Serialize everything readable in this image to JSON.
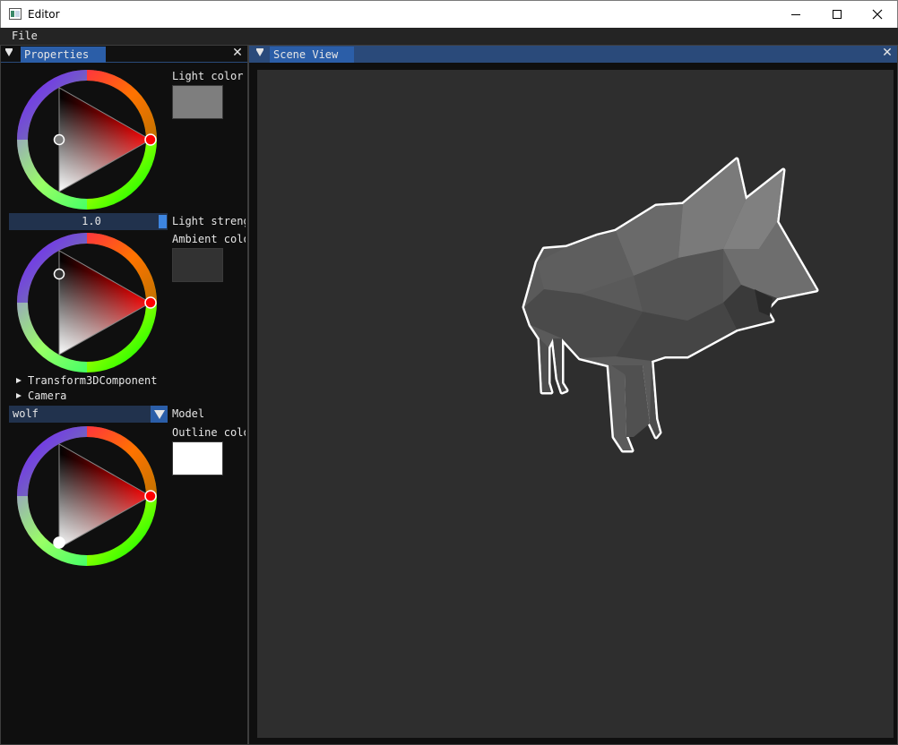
{
  "window": {
    "title": "Editor",
    "menu": [
      "File"
    ]
  },
  "properties_panel": {
    "tab_label": "Properties",
    "light_color": {
      "label": "Light color",
      "value": "#7e7e7e",
      "hue_color": "#ff0000"
    },
    "light_strength": {
      "value": "1.0",
      "label": "Light streng"
    },
    "ambient_color": {
      "label": "Ambient colo",
      "value": "#323232",
      "hue_color": "#ff0000"
    },
    "tree": [
      {
        "label": "Transform3DComponent"
      },
      {
        "label": "Camera"
      }
    ],
    "model": {
      "selected": "wolf",
      "label": "Model"
    },
    "outline_color": {
      "label": "Outline colo",
      "value": "#ffffff",
      "hue_color": "#ff0000"
    }
  },
  "scene_panel": {
    "tab_label": "Scene View",
    "viewport_bg": "#2e2e2e",
    "model_fill": "#5a5a5a",
    "outline": "#ffffff"
  }
}
